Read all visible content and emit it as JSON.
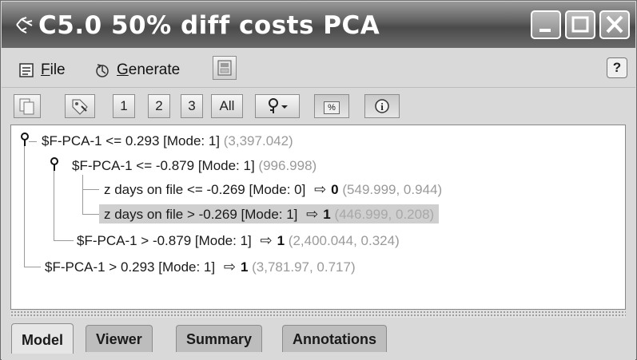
{
  "window": {
    "title": "C5.0 50% diff costs PCA",
    "icon": "tree-model-icon"
  },
  "menubar": {
    "file_label": "File",
    "file_underline": "F",
    "file_rest": "ile",
    "generate_underline": "G",
    "generate_rest": "enerate",
    "help_label": "?"
  },
  "toolbar": {
    "btn_1": "1",
    "btn_2": "2",
    "btn_3": "3",
    "btn_all": "All",
    "btn_percent": "%"
  },
  "tree": {
    "nodes": [
      {
        "condition": "$F-PCA-1 <= 0.293",
        "mode": "[Mode: 1]",
        "prediction": "",
        "stats": "(3,397.042)"
      },
      {
        "condition": "$F-PCA-1 <= -0.879",
        "mode": "[Mode: 1]",
        "prediction": "",
        "stats": "(996.998)"
      },
      {
        "condition": "z days on file <= -0.269",
        "mode": "[Mode: 0]",
        "prediction": "0",
        "stats": "(549.999, 0.944)"
      },
      {
        "condition": "z days on file > -0.269",
        "mode": "[Mode: 1]",
        "prediction": "1",
        "stats": "(446.999, 0.208)"
      },
      {
        "condition": "$F-PCA-1 > -0.879",
        "mode": "[Mode: 1]",
        "prediction": "1",
        "stats": "(2,400.044, 0.324)"
      },
      {
        "condition": "$F-PCA-1 > 0.293",
        "mode": "[Mode: 1]",
        "prediction": "1",
        "stats": "(3,781.97, 0.717)"
      }
    ],
    "arrow_glyph": "⇨"
  },
  "tabs": [
    {
      "label": "Model",
      "active": true
    },
    {
      "label": "Viewer",
      "active": false
    },
    {
      "label": "Summary",
      "active": false
    },
    {
      "label": "Annotations",
      "active": false
    }
  ]
}
